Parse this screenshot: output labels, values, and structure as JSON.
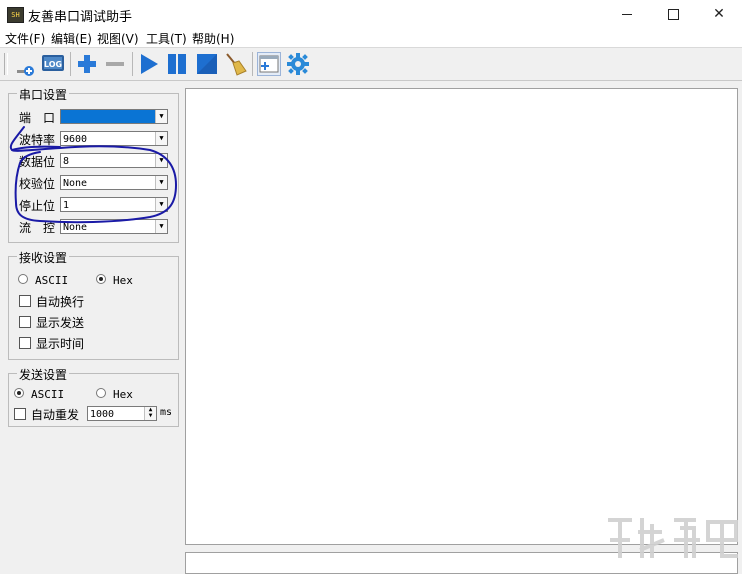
{
  "window": {
    "title": "友善串口调试助手",
    "icon_text": "SH",
    "controls": {
      "minimize": "minimize-icon",
      "maximize": "maximize-icon",
      "close": "close-icon"
    }
  },
  "menu": [
    "文件(F)",
    "编辑(E)",
    "视图(V)",
    "工具(T)",
    "帮助(H)"
  ],
  "toolbar": {
    "buttons": [
      "new-connection-icon",
      "log-icon",
      "add-icon",
      "remove-icon",
      "play-icon",
      "pause-icon",
      "stop-icon",
      "clear-broom-icon",
      "layout-icon",
      "settings-gear-icon"
    ],
    "log_label": "LOG"
  },
  "serial_settings": {
    "title": "串口设置",
    "port": {
      "label": "端　口",
      "value": ""
    },
    "baud": {
      "label": "波特率",
      "value": "9600"
    },
    "data_bits": {
      "label": "数据位",
      "value": "8"
    },
    "parity": {
      "label": "校验位",
      "value": "None"
    },
    "stop_bits": {
      "label": "停止位",
      "value": "1"
    },
    "flow": {
      "label": "流　控",
      "value": "None"
    }
  },
  "receive_settings": {
    "title": "接收设置",
    "ascii_label": "ASCII",
    "hex_label": "Hex",
    "selected": "Hex",
    "auto_newline": "自动换行",
    "show_send": "显示发送",
    "show_time": "显示时间"
  },
  "send_settings": {
    "title": "发送设置",
    "ascii_label": "ASCII",
    "hex_label": "Hex",
    "selected": "ASCII",
    "auto_resend": "自动重发",
    "interval": "1000",
    "unit": "ms"
  },
  "colors": {
    "annotation": "#1a1aa6",
    "selection": "#0a74d4",
    "play": "#1e6fd0"
  }
}
